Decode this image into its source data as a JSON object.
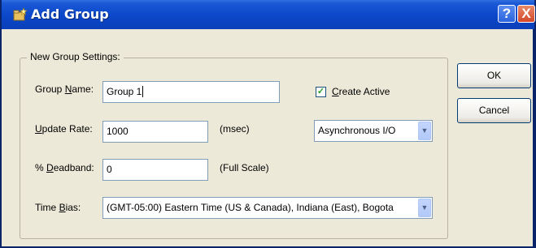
{
  "window": {
    "title": "Add Group",
    "help_glyph": "?",
    "close_glyph": "X"
  },
  "group_box": {
    "legend": "New Group Settings:"
  },
  "fields": {
    "group_name": {
      "label": "Group Name:",
      "value": "Group 1"
    },
    "update_rate": {
      "label": "Update Rate:",
      "value": "1000",
      "unit": "(msec)"
    },
    "deadband": {
      "label": "% Deadband:",
      "value": "0",
      "unit": "(Full Scale)"
    },
    "time_bias": {
      "label": "Time Bias:",
      "selected": "(GMT-05:00) Eastern Time (US & Canada), Indiana (East), Bogota"
    }
  },
  "create_active": {
    "label": "Create Active",
    "checked": true,
    "check_glyph": "✓"
  },
  "io_mode": {
    "selected": "Asynchronous I/O"
  },
  "buttons": {
    "ok": "OK",
    "cancel": "Cancel"
  },
  "dropdown_glyph": "▼",
  "icons": {
    "title": "group-add-icon"
  },
  "colors": {
    "title_bar": "#0b47c8",
    "client_bg": "#ece9d8",
    "close_btn": "#d4472a"
  }
}
